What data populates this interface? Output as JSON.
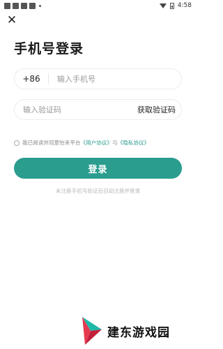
{
  "status_bar": {
    "time": "4:58"
  },
  "header": {
    "title": "手机号登录"
  },
  "phone_field": {
    "country_code": "+86",
    "placeholder": "输入手机号",
    "value": ""
  },
  "code_field": {
    "placeholder": "输入验证码",
    "value": "",
    "get_code_label": "获取验证码"
  },
  "agreement": {
    "checked": false,
    "prefix": "我已阅读并同意怡禾平台",
    "user_agreement": "《用户协议》",
    "and": "与",
    "privacy_policy": "《隐私协议》"
  },
  "login_button": {
    "label": "登录"
  },
  "hint": "未注册手机号验证后自动注册并登录",
  "watermark": {
    "text": "建东游戏园"
  },
  "colors": {
    "accent": "#2a9d8f",
    "watermark_red": "#e63950",
    "watermark_teal": "#1fb7a8"
  }
}
